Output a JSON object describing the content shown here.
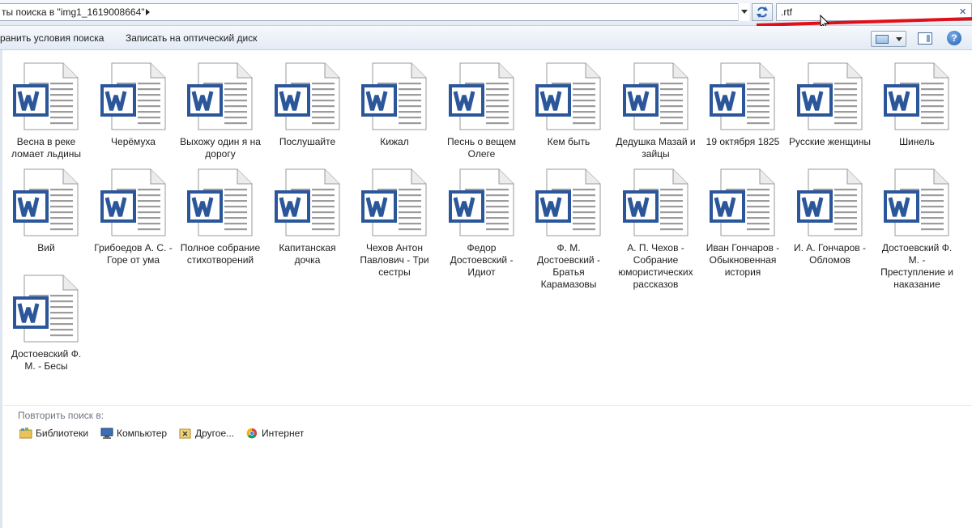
{
  "address_bar": {
    "path_text": "ты поиска в \"img1_1619008664\""
  },
  "search": {
    "query": ".rtf"
  },
  "toolbar": {
    "save_search": "ранить условия поиска",
    "burn": "Записать на оптический диск"
  },
  "files": [
    {
      "name": "Весна в реке ломает льдины"
    },
    {
      "name": "Черёмуха"
    },
    {
      "name": "Выхожу один я на дорогу"
    },
    {
      "name": "Послушайте"
    },
    {
      "name": "Кижал"
    },
    {
      "name": "Песнь о вещем Олеге"
    },
    {
      "name": "Кем быть"
    },
    {
      "name": "Дедушка Мазай и зайцы"
    },
    {
      "name": "19 октября 1825"
    },
    {
      "name": "Русские женщины"
    },
    {
      "name": "Шинель"
    },
    {
      "name": "Вий"
    },
    {
      "name": "Грибоедов А. С. - Горе от ума"
    },
    {
      "name": "Полное собрание стихотворений"
    },
    {
      "name": "Капитанская дочка"
    },
    {
      "name": "Чехов Антон Павлович - Три сестры"
    },
    {
      "name": "Федор Достоевский - Идиот"
    },
    {
      "name": "Ф. М. Достоевский - Братья Карамазовы"
    },
    {
      "name": "А. П. Чехов - Собрание юмористических рассказов"
    },
    {
      "name": "Иван Гончаров - Обыкновенная история"
    },
    {
      "name": "И. А. Гончаров - Обломов"
    },
    {
      "name": "Достоевский Ф. М. - Преступление и наказание"
    },
    {
      "name": "Достоевский Ф. М. - Бесы"
    }
  ],
  "search_again": {
    "title": "Повторить поиск в:",
    "locations": [
      {
        "label": "Библиотеки",
        "icon": "libraries-icon"
      },
      {
        "label": "Компьютер",
        "icon": "computer-icon"
      },
      {
        "label": "Другое...",
        "icon": "custom-folder-icon"
      },
      {
        "label": "Интернет",
        "icon": "chrome-icon"
      }
    ]
  },
  "colors": {
    "word_blue": "#2b579a",
    "annotation_red": "#e0101a"
  }
}
